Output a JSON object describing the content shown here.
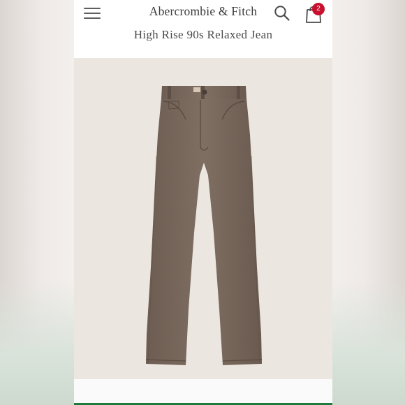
{
  "header": {
    "brand": "Abercrombie & Fitch",
    "menu_icon": "hamburger-menu-icon",
    "search_icon": "search-icon",
    "bag_icon": "shopping-bag-icon",
    "bag_count": "2"
  },
  "product": {
    "title": "High Rise 90s Relaxed Jean",
    "image_icon": "jeans-product-image"
  },
  "colors": {
    "badge": "#c8102e",
    "jean": "#7a6a5e",
    "accent_bar": "#1f7a3e"
  }
}
